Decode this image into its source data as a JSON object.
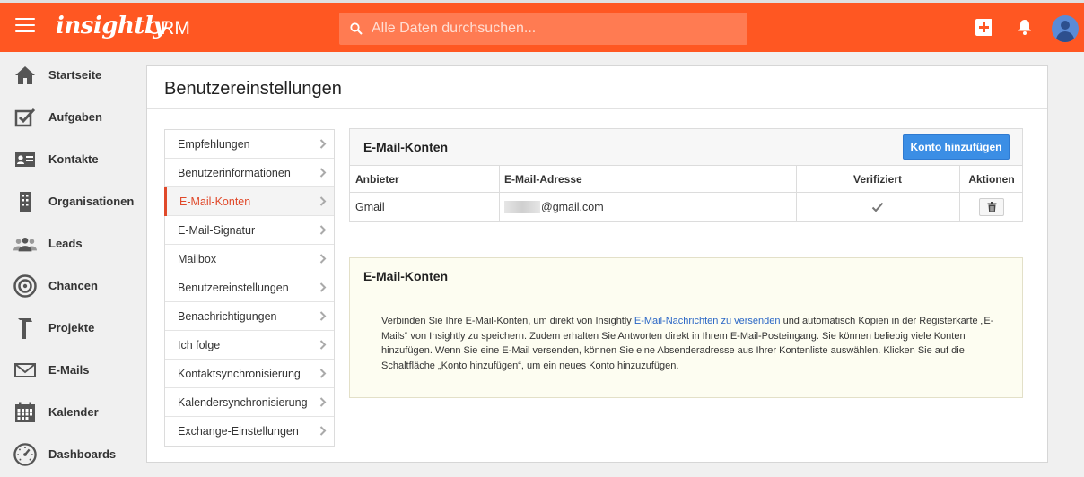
{
  "app": {
    "logo": "insightly",
    "product": "CRM"
  },
  "search": {
    "placeholder": "Alle Daten durchsuchen..."
  },
  "nav": {
    "items": [
      {
        "label": "Startseite",
        "icon": "home-icon"
      },
      {
        "label": "Aufgaben",
        "icon": "task-check-icon"
      },
      {
        "label": "Kontakte",
        "icon": "contact-card-icon"
      },
      {
        "label": "Organisationen",
        "icon": "building-icon"
      },
      {
        "label": "Leads",
        "icon": "people-group-icon"
      },
      {
        "label": "Chancen",
        "icon": "target-icon"
      },
      {
        "label": "Projekte",
        "icon": "hammer-icon"
      },
      {
        "label": "E-Mails",
        "icon": "envelope-icon"
      },
      {
        "label": "Kalender",
        "icon": "calendar-icon"
      },
      {
        "label": "Dashboards",
        "icon": "gauge-icon"
      }
    ]
  },
  "page": {
    "title": "Benutzereinstellungen"
  },
  "settings_menu": {
    "items": [
      "Empfehlungen",
      "Benutzerinformationen",
      "E-Mail-Konten",
      "E-Mail-Signatur",
      "Mailbox",
      "Benutzereinstellungen",
      "Benachrichtigungen",
      "Ich folge",
      "Kontaktsynchronisierung",
      "Kalendersynchronisierung",
      "Exchange-Einstellungen"
    ],
    "active": "E-Mail-Konten"
  },
  "accounts": {
    "title": "E-Mail-Konten",
    "add_button": "Konto hinzufügen",
    "columns": [
      "Anbieter",
      "E-Mail-Adresse",
      "Verifiziert",
      "Aktionen"
    ],
    "rows": [
      {
        "provider": "Gmail",
        "email_suffix": "@gmail.com",
        "verified": true
      }
    ]
  },
  "info": {
    "title": "E-Mail-Konten",
    "text_before_link": "Verbinden Sie Ihre E-Mail-Konten, um direkt von Insightly ",
    "link": "E-Mail-Nachrichten zu versenden",
    "text_after_link": " und automatisch Kopien in der Registerkarte „E-Mails“ von Insightly zu speichern. Zudem erhalten Sie Antworten direkt in Ihrem E-Mail-Posteingang. Sie können beliebig viele Konten hinzufügen. Wenn Sie eine E-Mail versenden, können Sie eine Absenderadresse aus Ihrer Kontenliste auswählen. Klicken Sie auf die Schaltfläche „Konto hinzufügen“, um ein neues Konto hinzuzufügen."
  },
  "colors": {
    "brand": "#ff5722",
    "accent_button": "#3b8ee5",
    "active_menu": "#e0492a"
  }
}
